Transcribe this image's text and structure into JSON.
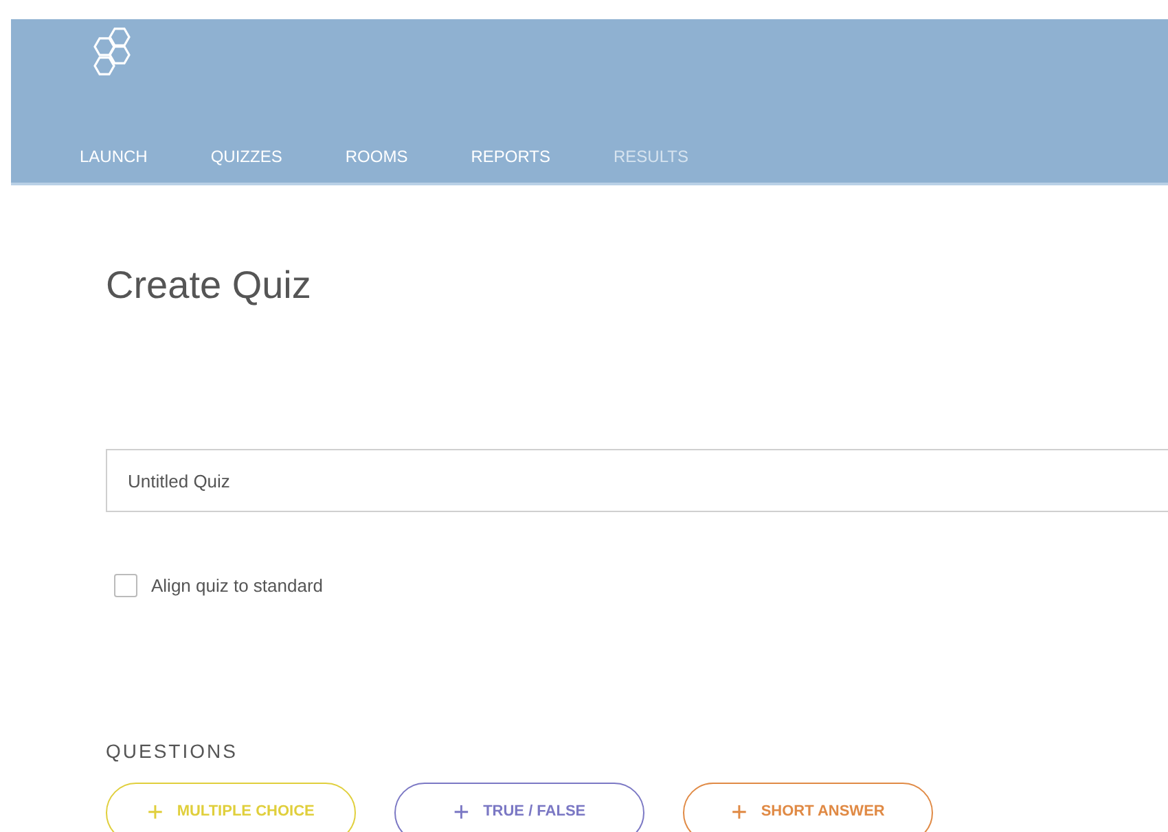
{
  "nav": [
    {
      "label": "LAUNCH",
      "disabled": false
    },
    {
      "label": "QUIZZES",
      "disabled": false
    },
    {
      "label": "ROOMS",
      "disabled": false
    },
    {
      "label": "REPORTS",
      "disabled": false
    },
    {
      "label": "RESULTS",
      "disabled": true
    }
  ],
  "page_title": "Create Quiz",
  "quiz_name": {
    "value": "Untitled Quiz"
  },
  "align_standard": {
    "label": "Align quiz to standard",
    "checked": false
  },
  "questions": {
    "heading": "QUESTIONS",
    "buttons": [
      {
        "icon": "+",
        "label": "MULTIPLE CHOICE",
        "color": "#e0cf3c"
      },
      {
        "icon": "+",
        "label": "TRUE / FALSE",
        "color": "#7b78c4"
      },
      {
        "icon": "+",
        "label": "SHORT ANSWER",
        "color": "#e08a45"
      }
    ]
  }
}
